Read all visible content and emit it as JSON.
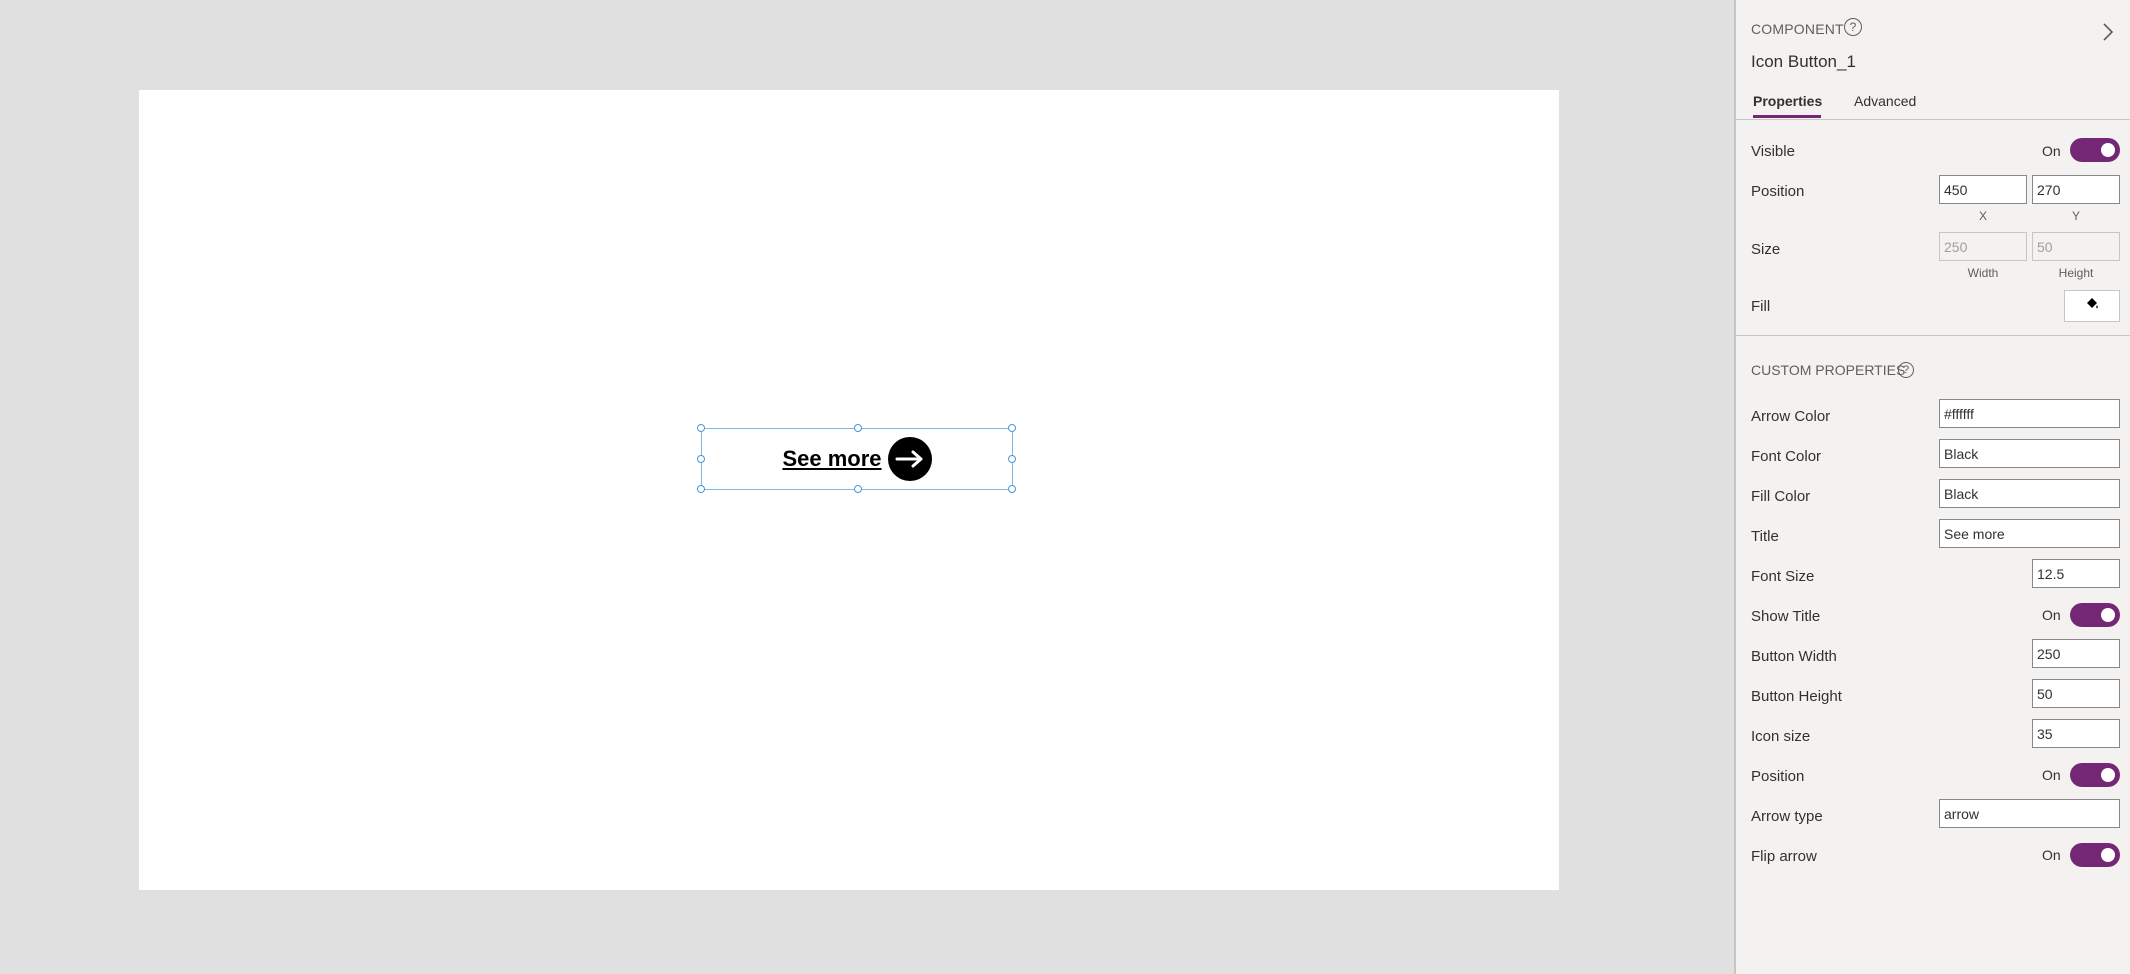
{
  "canvas": {
    "button_title": "See more"
  },
  "panel": {
    "section_label": "COMPONENT",
    "component_name": "Icon Button_1",
    "tabs": [
      {
        "label": "Properties",
        "active": true
      },
      {
        "label": "Advanced",
        "active": false
      }
    ],
    "visible": {
      "label": "Visible",
      "state": "On"
    },
    "position": {
      "label": "Position",
      "x": "450",
      "y": "270",
      "x_label": "X",
      "y_label": "Y"
    },
    "size": {
      "label": "Size",
      "width": "250",
      "height": "50",
      "width_label": "Width",
      "height_label": "Height"
    },
    "fill": {
      "label": "Fill",
      "icon": "paint-bucket-icon"
    },
    "custom_section_label": "CUSTOM PROPERTIES",
    "custom": {
      "arrow_color": {
        "label": "Arrow Color",
        "value": "#ffffff"
      },
      "font_color": {
        "label": "Font Color",
        "value": "Black"
      },
      "fill_color": {
        "label": "Fill Color",
        "value": "Black"
      },
      "title": {
        "label": "Title",
        "value": "See more"
      },
      "font_size": {
        "label": "Font Size",
        "value": "12.5"
      },
      "show_title": {
        "label": "Show Title",
        "state": "On"
      },
      "button_width": {
        "label": "Button Width",
        "value": "250"
      },
      "button_height": {
        "label": "Button Height",
        "value": "50"
      },
      "icon_size": {
        "label": "Icon size",
        "value": "35"
      },
      "position": {
        "label": "Position",
        "state": "On"
      },
      "arrow_type": {
        "label": "Arrow type",
        "value": "arrow"
      },
      "flip_arrow": {
        "label": "Flip arrow",
        "state": "On"
      }
    }
  },
  "colors": {
    "accent": "#742774",
    "selection": "#4a96d8",
    "canvas_bg": "#e0e0e0",
    "panel_bg": "#f3f2f1"
  }
}
